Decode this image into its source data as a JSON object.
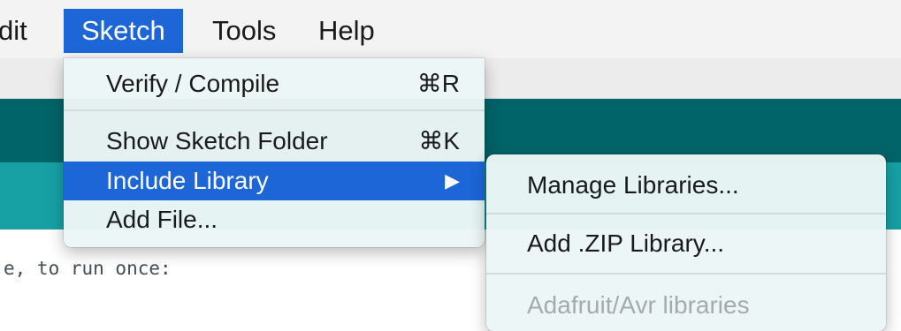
{
  "menubar": {
    "items": [
      {
        "label": "dit"
      },
      {
        "label": "Sketch"
      },
      {
        "label": "Tools"
      },
      {
        "label": "Help"
      }
    ]
  },
  "editor": {
    "code_line": "e, to run once:"
  },
  "sketch_menu": {
    "items": [
      {
        "label": "Verify / Compile",
        "shortcut": "⌘R"
      },
      {
        "label": "Show Sketch Folder",
        "shortcut": "⌘K"
      },
      {
        "label": "Include Library",
        "submenu_arrow": "▶"
      },
      {
        "label": "Add File..."
      }
    ]
  },
  "include_library_submenu": {
    "items": [
      {
        "label": "Manage Libraries..."
      },
      {
        "label": "Add .ZIP Library..."
      },
      {
        "label": "Adafruit/Avr libraries",
        "disabled": true
      }
    ]
  },
  "colors": {
    "highlight": "#1c66d8",
    "toolbar_dark": "#006468",
    "tabs_band": "#17a1a5"
  }
}
